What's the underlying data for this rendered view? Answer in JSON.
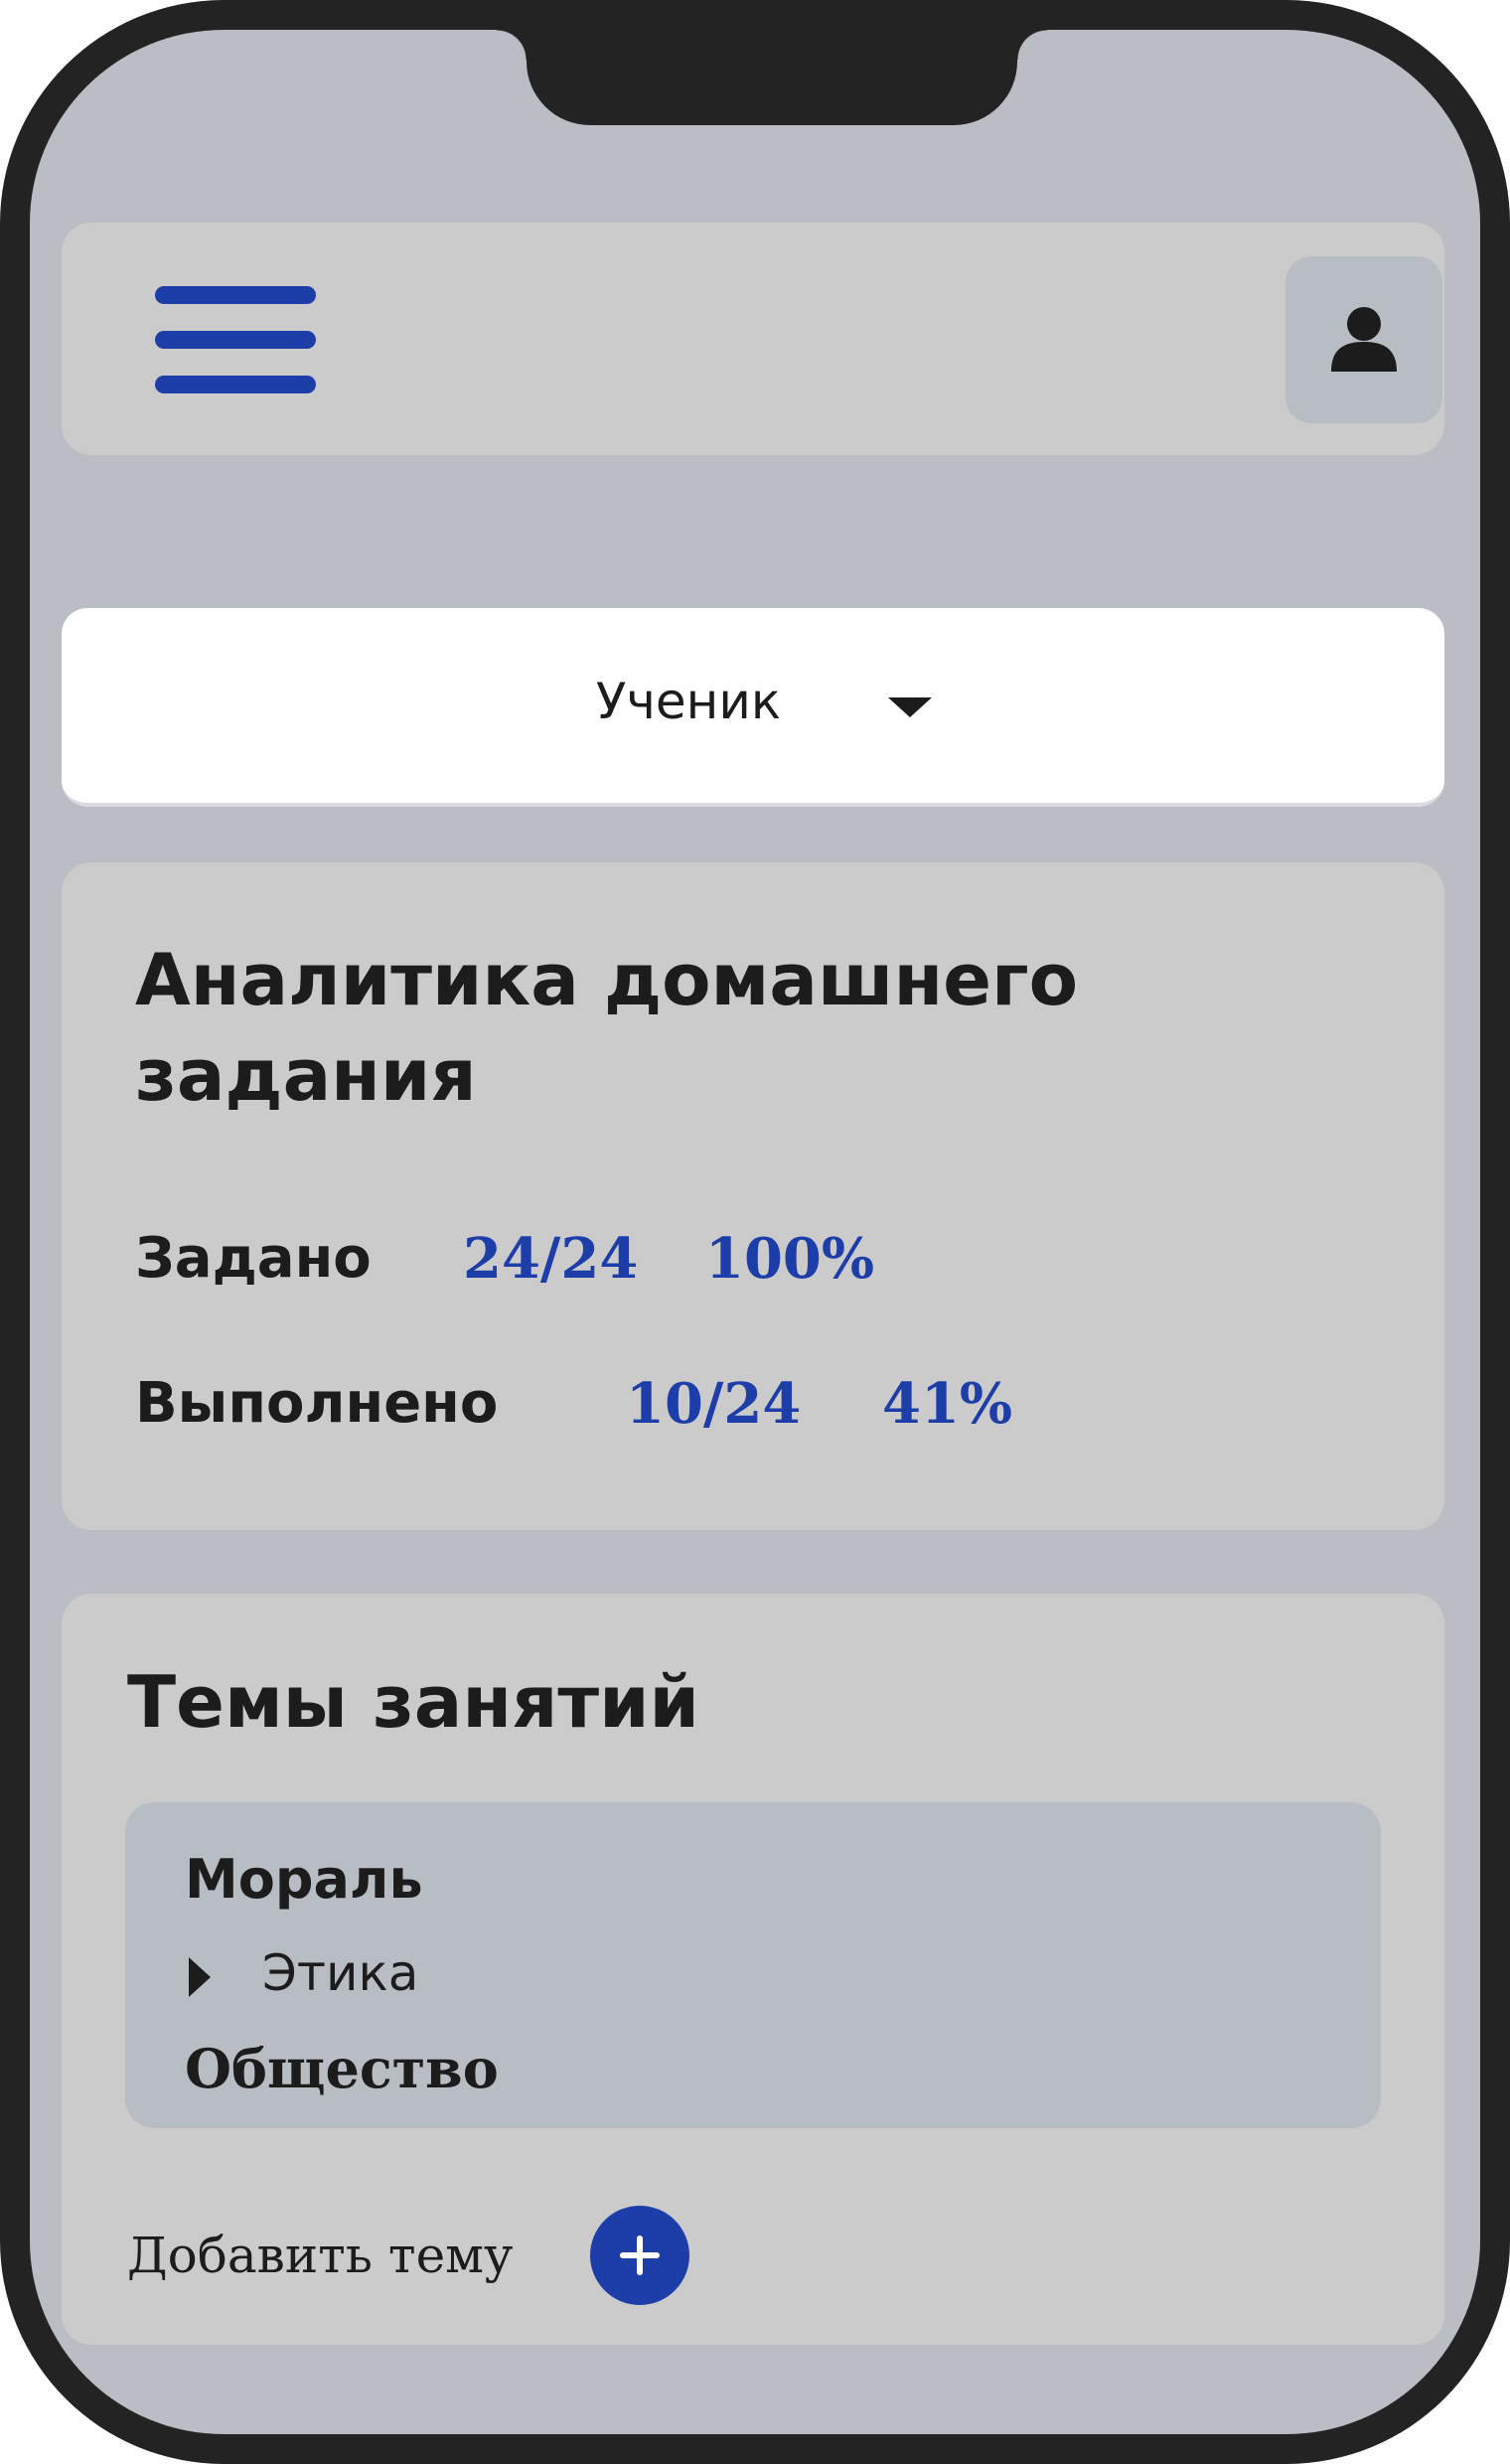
{
  "role_select": {
    "value": "Ученик"
  },
  "analytics": {
    "title": "Аналитика домашнего задания",
    "assigned": {
      "label": "Задано",
      "count": "24/24",
      "percent": "100%"
    },
    "completed": {
      "label": "Выполнено",
      "count": "10/24",
      "percent": "41%"
    }
  },
  "topics": {
    "title": "Темы занятий",
    "items": [
      {
        "label": "Мораль",
        "subitems": [
          "Этика"
        ]
      },
      {
        "label": "Общество",
        "subitems": []
      }
    ],
    "add_label": "Добавить тему"
  },
  "icons": {
    "menu": "hamburger-menu-icon",
    "profile": "user-icon",
    "dropdown": "caret-down-icon",
    "subtopic": "caret-right-icon",
    "add": "plus-icon"
  },
  "colors": {
    "accent": "#1d3ea8",
    "screen_bg": "#babdc4",
    "card_bg": "#cbcbcb",
    "nested_bg": "#b8bcc3",
    "frame": "#232323"
  }
}
